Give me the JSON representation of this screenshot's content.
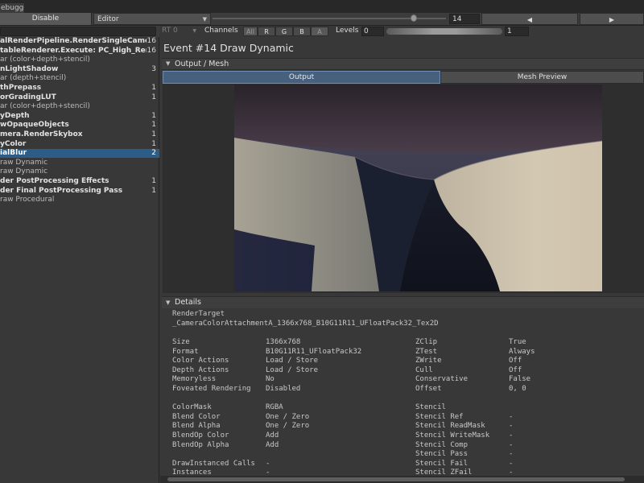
{
  "window": {
    "tab_label": "ebugger"
  },
  "toolbar": {
    "disable_label": "Disable",
    "target_value": "Editor",
    "event_index": "14",
    "prev_icon": "triangle-left",
    "next_icon": "triangle-right"
  },
  "events": [
    {
      "label": "alRenderPipeline.RenderSingleCameraInte",
      "count": "16",
      "style": "bold"
    },
    {
      "label": "tableRenderer.Execute: PC_High_Rendere",
      "count": "16",
      "style": "bold"
    },
    {
      "label": "ar (color+depth+stencil)",
      "count": "",
      "style": "leaf"
    },
    {
      "label": "nLightShadow",
      "count": "3",
      "style": "bold"
    },
    {
      "label": "ar (depth+stencil)",
      "count": "",
      "style": "leaf"
    },
    {
      "label": "thPrepass",
      "count": "1",
      "style": "bold"
    },
    {
      "label": "orGradingLUT",
      "count": "1",
      "style": "bold"
    },
    {
      "label": "ar (color+depth+stencil)",
      "count": "",
      "style": "leaf"
    },
    {
      "label": "yDepth",
      "count": "1",
      "style": "bold"
    },
    {
      "label": "wOpaqueObjects",
      "count": "1",
      "style": "bold"
    },
    {
      "label": "mera.RenderSkybox",
      "count": "1",
      "style": "bold"
    },
    {
      "label": "yColor",
      "count": "1",
      "style": "bold"
    },
    {
      "label": "ialBlur",
      "count": "2",
      "style": "bold",
      "selected": true
    },
    {
      "label": "raw Dynamic",
      "count": "",
      "style": "leaf"
    },
    {
      "label": "raw Dynamic",
      "count": "",
      "style": "leaf"
    },
    {
      "label": "der PostProcessing Effects",
      "count": "1",
      "style": "bold"
    },
    {
      "label": "der Final PostProcessing Pass",
      "count": "1",
      "style": "bold"
    },
    {
      "label": "raw Procedural",
      "count": "",
      "style": "leaf"
    }
  ],
  "render_target_bar": {
    "rt_label": "RT 0",
    "channels_label": "Channels",
    "channels": [
      "All",
      "R",
      "G",
      "B",
      "A"
    ],
    "levels_label": "Levels",
    "level_min": "0",
    "level_max": "1"
  },
  "event": {
    "title": "Event #14 Draw Dynamic",
    "output_section_label": "Output / Mesh",
    "tabs": [
      "Output",
      "Mesh Preview"
    ],
    "active_tab": "Output"
  },
  "details": {
    "section_label": "Details",
    "render_target_label": "RenderTarget",
    "render_target_value": "_CameraColorAttachmentA_1366x768_B10G11R11_UFloatPack32_Tex2D",
    "left_rows": [
      {
        "k": "Size",
        "v": "1366x768"
      },
      {
        "k": "Format",
        "v": "B10G11R11_UFloatPack32"
      },
      {
        "k": "Color Actions",
        "v": "Load / Store"
      },
      {
        "k": "Depth Actions",
        "v": "Load / Store"
      },
      {
        "k": "Memoryless",
        "v": "No"
      },
      {
        "k": "Foveated Rendering",
        "v": "Disabled"
      },
      {
        "k": "",
        "v": ""
      },
      {
        "k": "ColorMask",
        "v": "RGBA"
      },
      {
        "k": "Blend Color",
        "v": "One / Zero"
      },
      {
        "k": "Blend Alpha",
        "v": "One / Zero"
      },
      {
        "k": "BlendOp Color",
        "v": "Add"
      },
      {
        "k": "BlendOp Alpha",
        "v": "Add"
      },
      {
        "k": "",
        "v": ""
      },
      {
        "k": "DrawInstanced Calls",
        "v": "-"
      },
      {
        "k": "Instances",
        "v": "-"
      }
    ],
    "right_rows": [
      {
        "k": "ZClip",
        "v": "True"
      },
      {
        "k": "ZTest",
        "v": "Always"
      },
      {
        "k": "ZWrite",
        "v": "Off"
      },
      {
        "k": "Cull",
        "v": "Off"
      },
      {
        "k": "Conservative",
        "v": "False"
      },
      {
        "k": "Offset",
        "v": "0, 0"
      },
      {
        "k": "",
        "v": ""
      },
      {
        "k": "Stencil",
        "v": ""
      },
      {
        "k": "Stencil Ref",
        "v": "-"
      },
      {
        "k": "Stencil ReadMask",
        "v": "-"
      },
      {
        "k": "Stencil WriteMask",
        "v": "-"
      },
      {
        "k": "Stencil Comp",
        "v": "-"
      },
      {
        "k": "Stencil Pass",
        "v": "-"
      },
      {
        "k": "Stencil Fail",
        "v": "-"
      },
      {
        "k": "Stencil ZFail",
        "v": "-"
      }
    ]
  },
  "colors": {
    "selection": "#2c5d87",
    "active_tab": "#46607e",
    "panel_bg": "#383838"
  }
}
